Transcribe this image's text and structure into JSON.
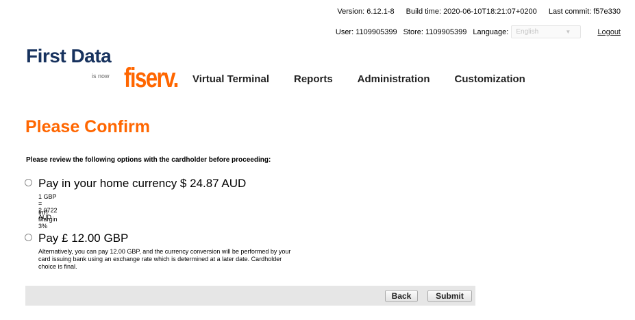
{
  "header": {
    "version": "Version: 6.12.1-8",
    "build_time": "Build time: 2020-06-10T18:21:07+0200",
    "last_commit": "Last commit: f57e330",
    "user": "User: 1109905399",
    "store": "Store: 1109905399",
    "language_label": "Language:",
    "language_value": "English",
    "logout": "Logout"
  },
  "logo": {
    "first_data": "First Data",
    "is_now": "is now",
    "fiserv": "fiserv."
  },
  "nav": {
    "items": [
      "Virtual Terminal",
      "Reports",
      "Administration",
      "Customization"
    ]
  },
  "page": {
    "title": "Please Confirm",
    "instruction": "Please review the following options with the cardholder before proceeding:"
  },
  "options": {
    "home_currency": {
      "label": "Pay in your home currency $ 24.87 AUD",
      "rate": "1 GBP = 2.0722 AUD",
      "margin": "Int'l Margin 3%",
      "selected": false
    },
    "original_currency": {
      "label": "Pay £ 12.00 GBP",
      "description": "Alternatively, you can pay 12.00 GBP, and the currency conversion will be performed by your card issuing bank using an exchange rate which is determined at a later date. Cardholder choice is final.",
      "selected": false
    }
  },
  "actions": {
    "back": "Back",
    "submit": "Submit"
  },
  "colors": {
    "brand_orange": "#ff6600",
    "brand_navy": "#17325e",
    "action_bar": "#e6e6e6"
  }
}
